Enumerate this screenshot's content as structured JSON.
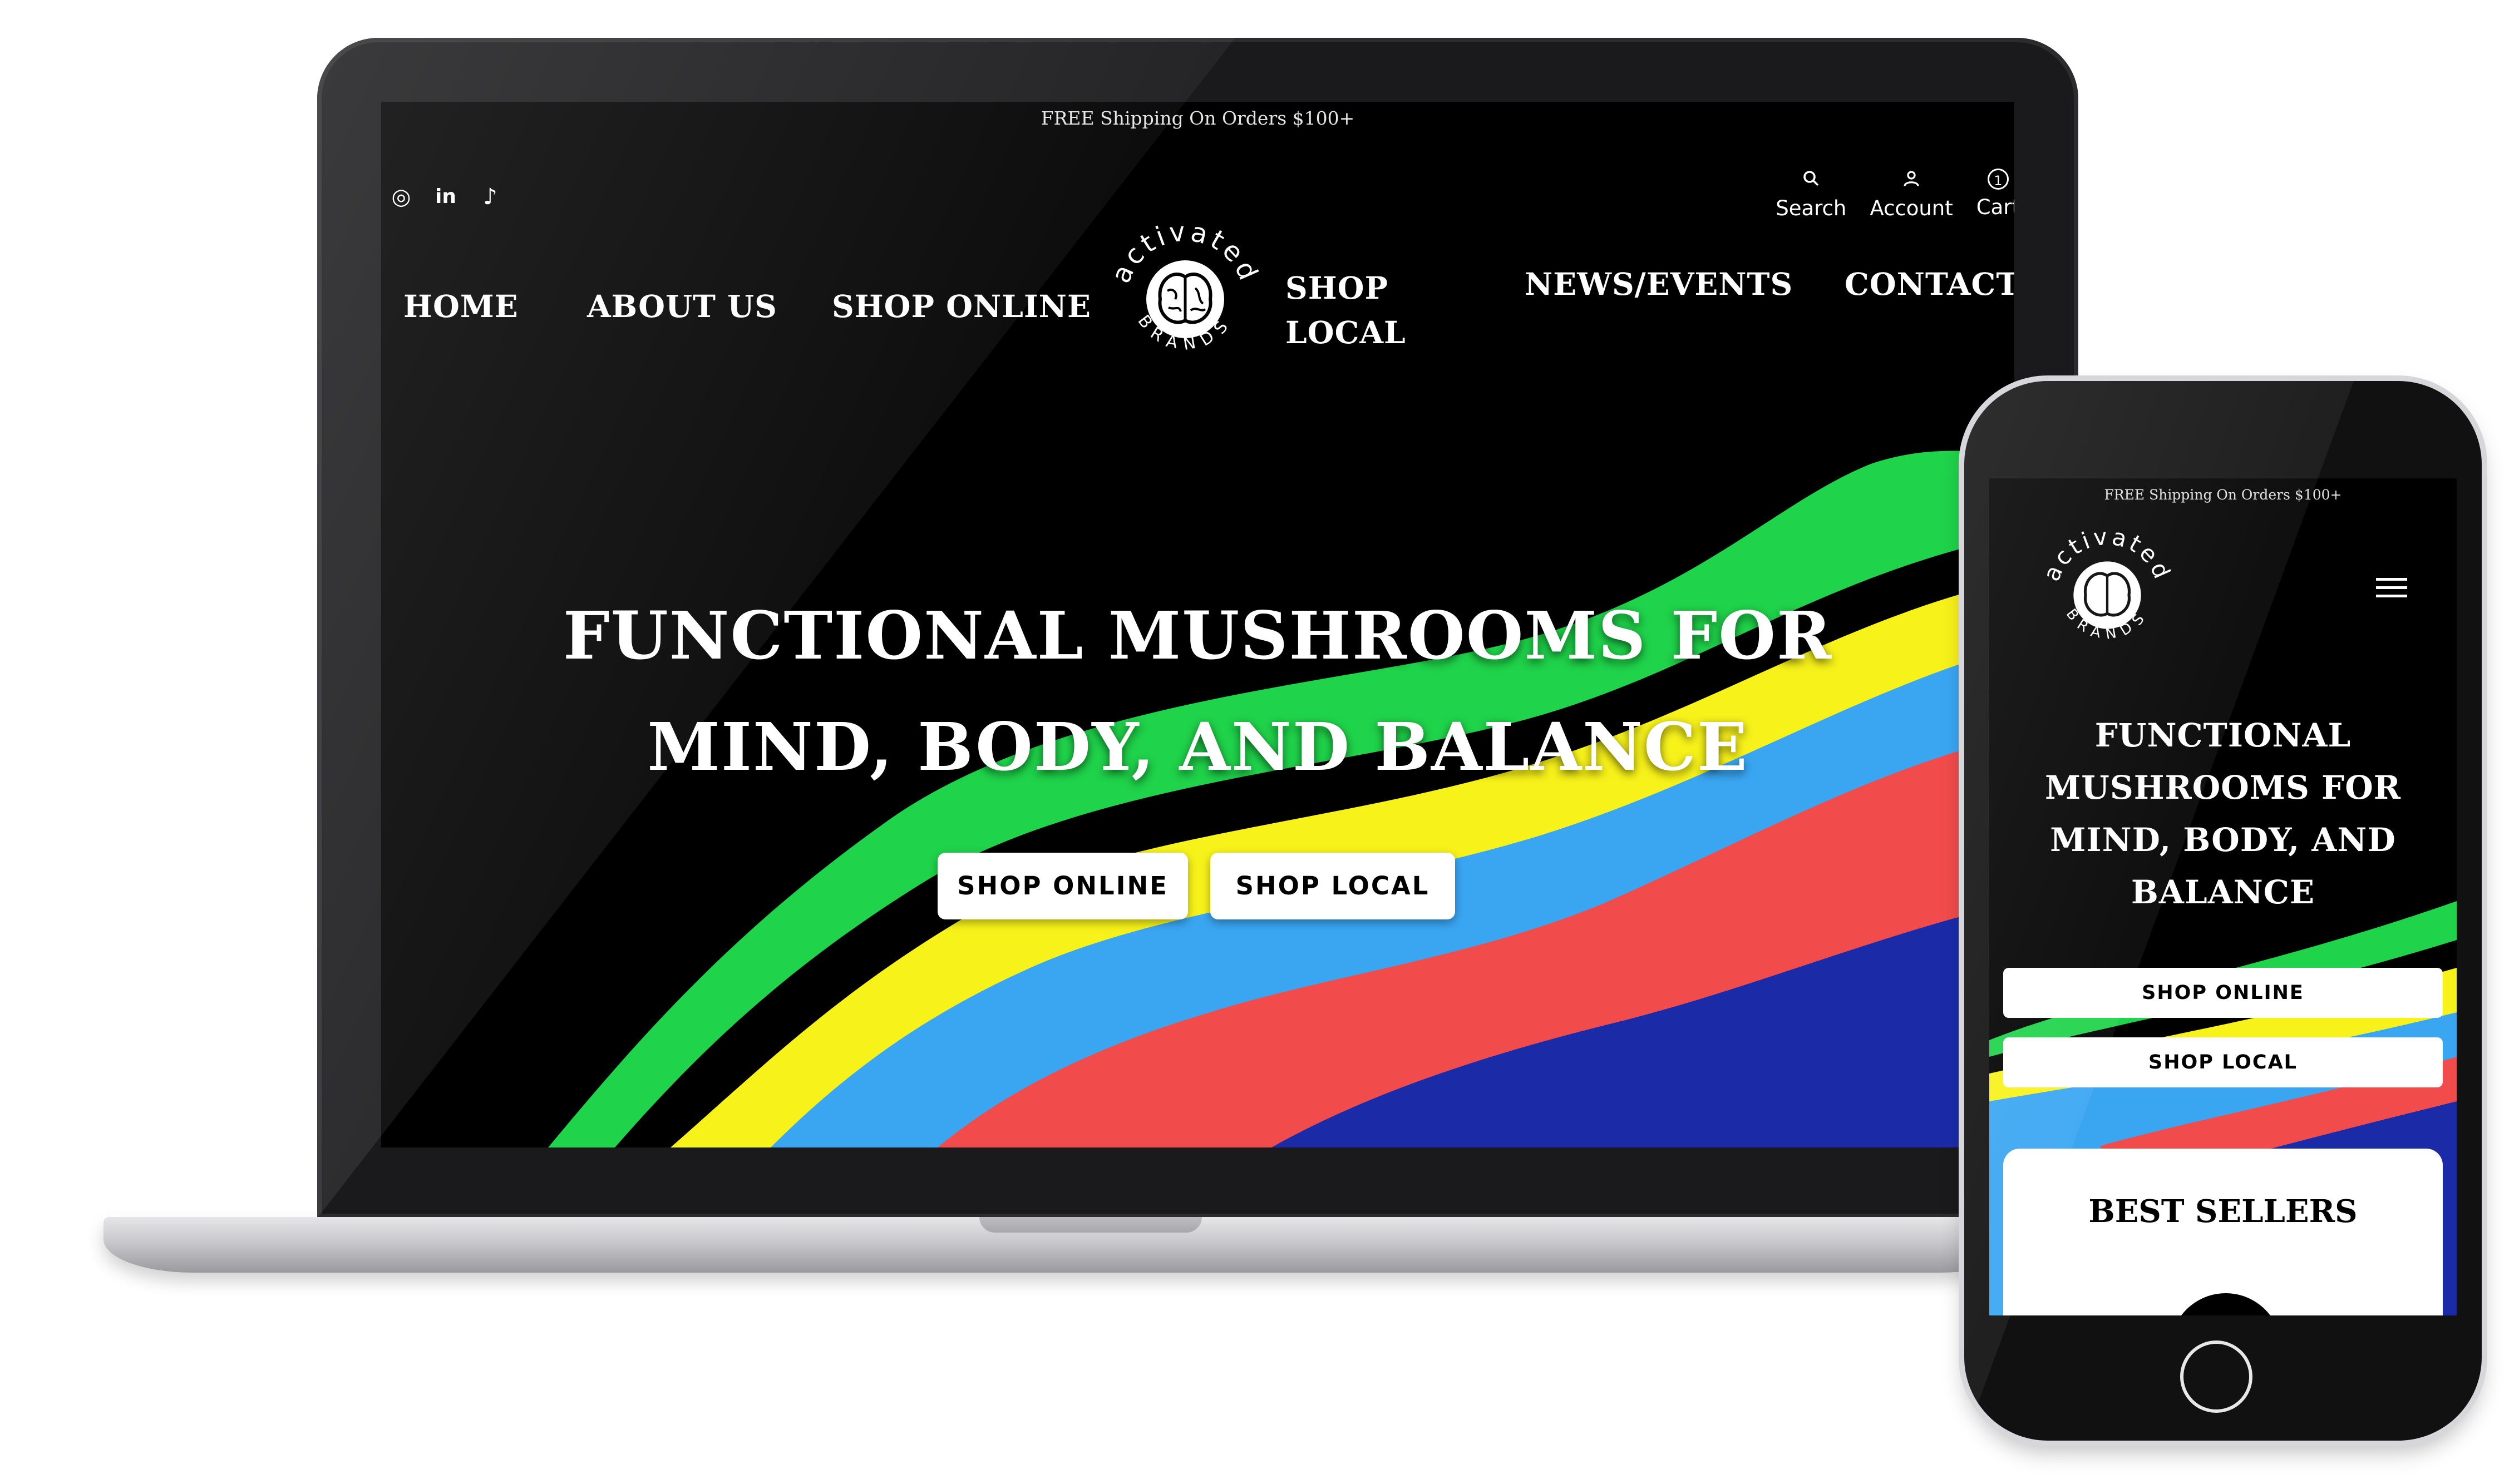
{
  "desktop": {
    "announcement": "FREE Shipping On Orders $100+",
    "social": [
      {
        "icon": "instagram-icon",
        "glyph": "◎"
      },
      {
        "icon": "linkedin-icon",
        "glyph": "in"
      },
      {
        "icon": "tiktok-icon",
        "glyph": "♪"
      }
    ],
    "utility": {
      "search_label": "Search",
      "account_label": "Account",
      "cart_label": "Cart",
      "cart_count": "1"
    },
    "nav": {
      "home": "HOME",
      "about": "ABOUT US",
      "shop_online": "SHOP ONLINE",
      "shop_local_line1": "SHOP",
      "shop_local_line2": "LOCAL",
      "news": "NEWS/EVENTS",
      "contact": "CONTACT"
    },
    "logo": {
      "top_text": "activated",
      "bottom_text": "BRANDS"
    },
    "hero": {
      "title_line1": "FUNCTIONAL MUSHROOMS FOR",
      "title_line2": "MIND, BODY, AND BALANCE",
      "btn_shop_online": "SHOP ONLINE",
      "btn_shop_local": "SHOP LOCAL"
    }
  },
  "mobile": {
    "announcement": "FREE Shipping On Orders $100+",
    "menu_icon": "hamburger-menu-icon",
    "hero": {
      "title_line1": "FUNCTIONAL",
      "title_line2": "MUSHROOMS FOR",
      "title_line3": "MIND, BODY, AND",
      "title_line4": "BALANCE",
      "btn_shop_online": "SHOP ONLINE",
      "btn_shop_local": "SHOP LOCAL"
    },
    "section_title": "BEST SELLERS"
  },
  "colors": {
    "background": "#000000",
    "green": "#1fd34a",
    "yellow": "#f7f21a",
    "blue": "#3aa6f2",
    "red": "#f24b4b",
    "navy": "#1b2ba8"
  }
}
